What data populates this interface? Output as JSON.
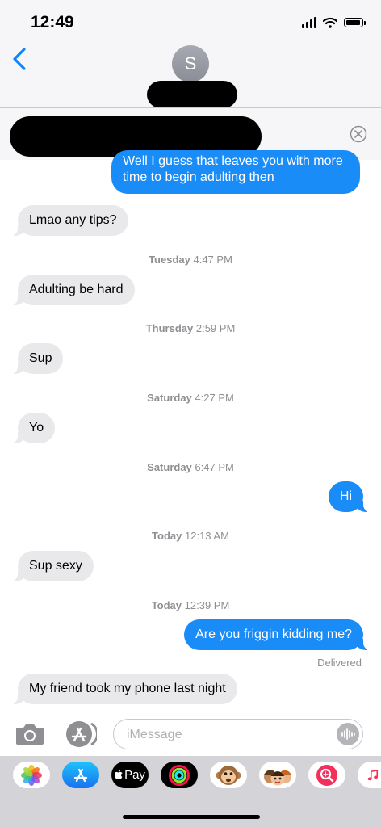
{
  "status_bar": {
    "time": "12:49"
  },
  "header": {
    "avatar_initial": "S"
  },
  "messages": [
    {
      "dir": "out",
      "text": "Well I guess that leaves you with more time to begin adulting then"
    },
    {
      "dir": "in",
      "text": "Lmao any tips?"
    },
    {
      "dir": "stamp",
      "day": "Tuesday",
      "time": "4:47 PM"
    },
    {
      "dir": "in",
      "text": "Adulting be hard"
    },
    {
      "dir": "stamp",
      "day": "Thursday",
      "time": "2:59 PM"
    },
    {
      "dir": "in",
      "text": "Sup"
    },
    {
      "dir": "stamp",
      "day": "Saturday",
      "time": "4:27 PM"
    },
    {
      "dir": "in",
      "text": "Yo"
    },
    {
      "dir": "stamp",
      "day": "Saturday",
      "time": "6:47 PM"
    },
    {
      "dir": "out",
      "text": "Hi"
    },
    {
      "dir": "stamp",
      "day": "Today",
      "time": "12:13 AM"
    },
    {
      "dir": "in",
      "text": "Sup sexy"
    },
    {
      "dir": "stamp",
      "day": "Today",
      "time": "12:39 PM"
    },
    {
      "dir": "out",
      "text": "Are you friggin kidding me?"
    },
    {
      "dir": "receipt",
      "text": "Delivered"
    },
    {
      "dir": "in",
      "text": "My friend took my phone last night"
    }
  ],
  "composer": {
    "placeholder": "iMessage"
  },
  "drawer": {
    "apps": [
      "photos-icon",
      "app-store-icon",
      "apple-pay-icon",
      "activity-icon",
      "monkey-animoji-icon",
      "memoji-icon",
      "web-search-icon",
      "music-icon"
    ],
    "apple_pay_label": "Pay"
  },
  "colors": {
    "outgoing": "#1a8cf8",
    "incoming": "#e9e9eb",
    "accent": "#0a84ff"
  }
}
